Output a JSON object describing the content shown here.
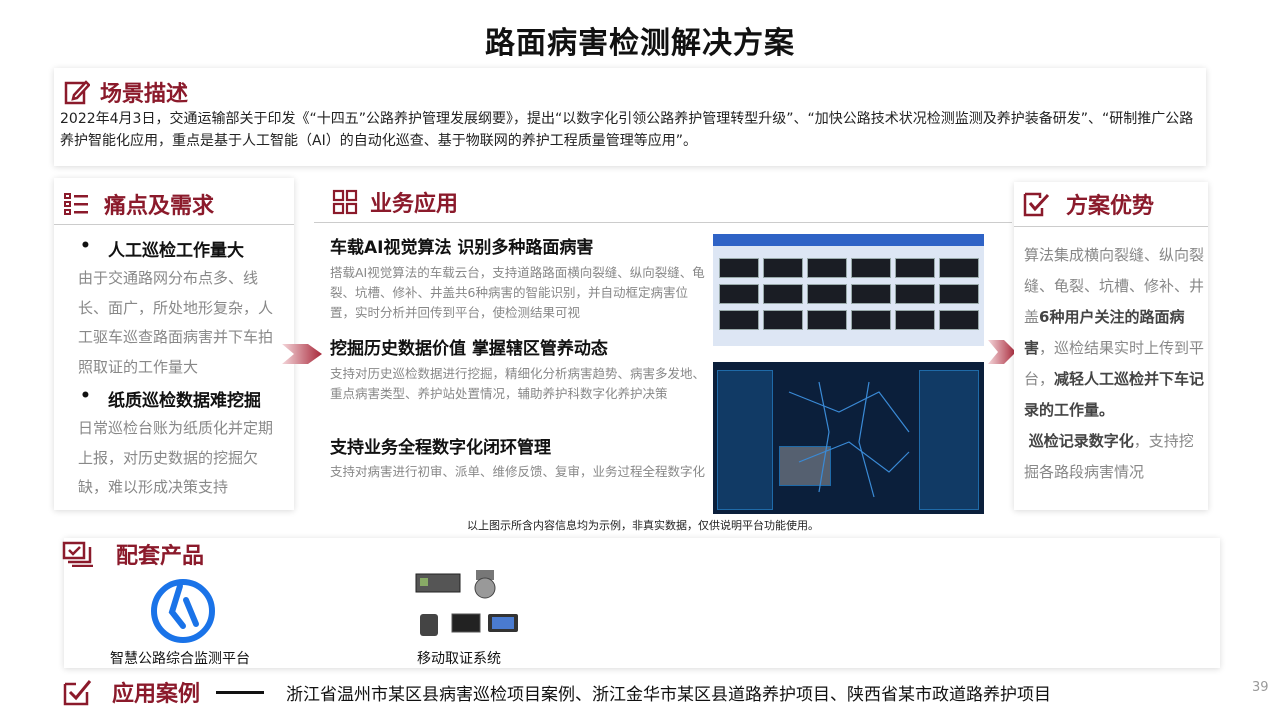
{
  "title": "路面病害检测解决方案",
  "scene": {
    "heading": "场景描述",
    "text": "2022年4月3日，交通运输部关于印发《“十四五”公路养护管理发展纲要》，提出“以数字化引领公路养护管理转型升级”、“加快公路技术状况检测监测及养护装备研发”、“研制推广公路养护智能化应用，重点是基于人工智能（AI）的自动化巡查、基于物联网的养护工程质量管理等应用”。"
  },
  "pain": {
    "heading": "痛点及需求",
    "items": [
      {
        "title": "人工巡检工作量大",
        "desc": "由于交通路网分布点多、线长、面广，所处地形复杂，人工驱车巡查路面病害并下车拍照取证的工作量大"
      },
      {
        "title": "纸质巡检数据难挖掘",
        "desc": "日常巡检台账为纸质化并定期上报，对历史数据的挖掘欠缺，难以形成决策支持"
      }
    ]
  },
  "business": {
    "heading": "业务应用",
    "items": [
      {
        "title": "车载AI视觉算法 识别多种路面病害",
        "desc": "搭载AI视觉算法的车载云台，支持道路路面横向裂缝、纵向裂缝、龟裂、坑槽、修补、井盖共6种病害的智能识别，并自动框定病害位置，实时分析并回传到平台，使检测结果可视"
      },
      {
        "title": "挖掘历史数据价值 掌握辖区管养动态",
        "desc": "支持对历史巡检数据进行挖掘，精细化分析病害趋势、病害多发地、重点病害类型、养护站处置情况，辅助养护科数字化养护决策"
      },
      {
        "title": "支持业务全程数字化闭环管理",
        "desc": "支持对病害进行初审、派单、维修反馈、复审，业务过程全程数字化"
      }
    ],
    "note": "以上图示所含内容信息均为示例，非真实数据，仅供说明平台功能使用。"
  },
  "advantage": {
    "heading": "方案优势",
    "part1": "算法集成横向裂缝、纵向裂缝、龟裂、坑槽、修补、井盖",
    "bold1": "6种用户关注的路面病害",
    "part2": "，巡检结果实时上传到平台，",
    "bold2": "减轻人工巡检并下车记录的工作量。",
    "bold3": "巡检记录数字化",
    "part3": "，支持挖掘各路段病害情况"
  },
  "products": {
    "heading": "配套产品",
    "items": [
      {
        "label": "智慧公路综合监测平台"
      },
      {
        "label": "移动取证系统"
      }
    ]
  },
  "cases": {
    "heading": "应用案例",
    "text": "浙江省温州市某区县病害巡检项目案例、浙江金华市某区县道路养护项目、陕西省某市政道路养护项目"
  },
  "page_number": "39",
  "colors": {
    "accent": "#8b1a2b",
    "platform_logo": "#1a73e8"
  }
}
